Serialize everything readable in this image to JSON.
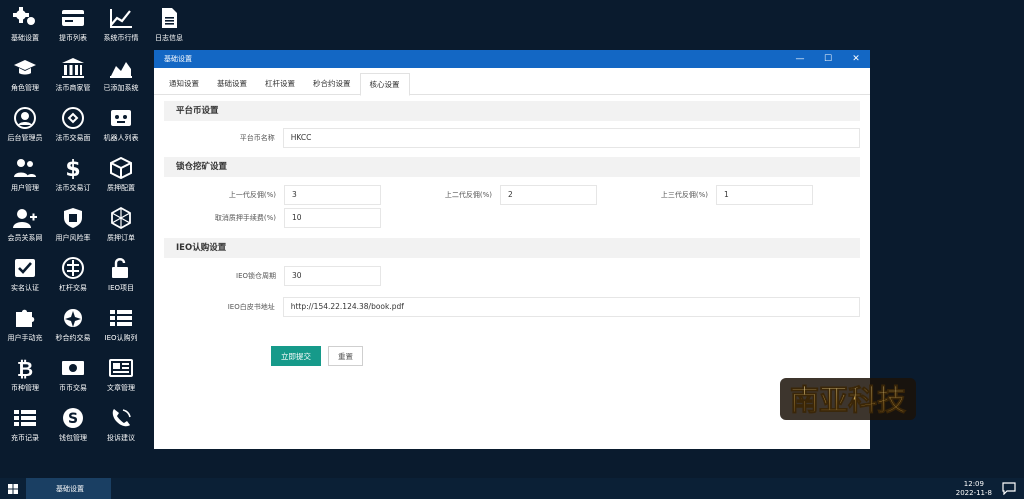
{
  "desktop_icons": [
    {
      "id": "settings",
      "label": "基础设置",
      "icon": "gears-icon"
    },
    {
      "id": "withdraw",
      "label": "提币列表",
      "icon": "card-icon"
    },
    {
      "id": "market",
      "label": "系统币行情",
      "icon": "chart-line-icon"
    },
    {
      "id": "log",
      "label": "日志信息",
      "icon": "document-icon"
    },
    {
      "id": "role",
      "label": "角色管理",
      "icon": "graduation-cap-icon"
    },
    {
      "id": "merchant",
      "label": "法币商家管",
      "icon": "bank-icon"
    },
    {
      "id": "added",
      "label": "已添加系统",
      "icon": "area-chart-icon"
    },
    {
      "id": "admin",
      "label": "后台管理员",
      "icon": "user-circle-icon"
    },
    {
      "id": "otc",
      "label": "法币交易面",
      "icon": "exchange-icon"
    },
    {
      "id": "robot",
      "label": "机器人列表",
      "icon": "robot-icon"
    },
    {
      "id": "users",
      "label": "用户管理",
      "icon": "users-icon"
    },
    {
      "id": "otc_order",
      "label": "法币交易订",
      "icon": "dollar-icon"
    },
    {
      "id": "pledge_cfg",
      "label": "质押配置",
      "icon": "cube-icon"
    },
    {
      "id": "relation",
      "label": "会员关系网",
      "icon": "user-plus-icon"
    },
    {
      "id": "risk",
      "label": "用户风险率",
      "icon": "shield-icon"
    },
    {
      "id": "pledge_order",
      "label": "质押订单",
      "icon": "hexagon-icon"
    },
    {
      "id": "auth",
      "label": "实名认证",
      "icon": "check-square-icon"
    },
    {
      "id": "lever",
      "label": "杠杆交易",
      "icon": "lever-icon"
    },
    {
      "id": "ieo",
      "label": "IEO项目",
      "icon": "unlock-icon"
    },
    {
      "id": "manual",
      "label": "用户手动充",
      "icon": "puzzle-icon"
    },
    {
      "id": "second",
      "label": "秒合约交易",
      "icon": "rebel-icon"
    },
    {
      "id": "ieo_list",
      "label": "IEO认购列",
      "icon": "list-icon"
    },
    {
      "id": "coin",
      "label": "币种管理",
      "icon": "bitcoin-icon"
    },
    {
      "id": "c2c",
      "label": "币币交易",
      "icon": "money-icon"
    },
    {
      "id": "article",
      "label": "文章管理",
      "icon": "newspaper-icon"
    },
    {
      "id": "recharge",
      "label": "充币记录",
      "icon": "list-icon"
    },
    {
      "id": "wallet",
      "label": "钱包管理",
      "icon": "skype-icon"
    },
    {
      "id": "complaint",
      "label": "投诉建议",
      "icon": "phone-icon"
    }
  ],
  "window": {
    "title": "基础设置",
    "controls": {
      "minimize": "—",
      "maximize": "☐",
      "close": "✕"
    },
    "tabs": [
      {
        "label": "通知设置",
        "active": false
      },
      {
        "label": "基础设置",
        "active": false
      },
      {
        "label": "杠杆设置",
        "active": false
      },
      {
        "label": "秒合约设置",
        "active": false
      },
      {
        "label": "核心设置",
        "active": true
      }
    ],
    "sections": {
      "platform": {
        "title": "平台币设置",
        "coin_name_label": "平台币名称",
        "coin_name_value": "HKCC"
      },
      "mining": {
        "title": "锁仓挖矿设置",
        "rebate1_label": "上一代反佣(%)",
        "rebate1_value": "3",
        "rebate2_label": "上二代反佣(%)",
        "rebate2_value": "2",
        "rebate3_label": "上三代反佣(%)",
        "rebate3_value": "1",
        "cancel_fee_label": "取消质押手续费(%)",
        "cancel_fee_value": "10"
      },
      "ieo": {
        "title": "IEO认购设置",
        "lock_period_label": "IEO锁仓周期",
        "lock_period_value": "30",
        "whitepaper_label": "IEO白皮书地址",
        "whitepaper_value": "http://154.22.124.38/book.pdf"
      }
    },
    "buttons": {
      "submit": "立即提交",
      "reset": "重置"
    }
  },
  "logo": {
    "text": "南亚科技"
  },
  "taskbar": {
    "active_task": "基础设置",
    "time": "12:09",
    "date": "2022-11-8"
  },
  "colors": {
    "desktop_bg": "#0a1b2e",
    "titlebar": "#1367c4",
    "primary_button": "#169a8a",
    "taskbar": "#0b2036",
    "taskbar_active": "#1a3f63"
  }
}
